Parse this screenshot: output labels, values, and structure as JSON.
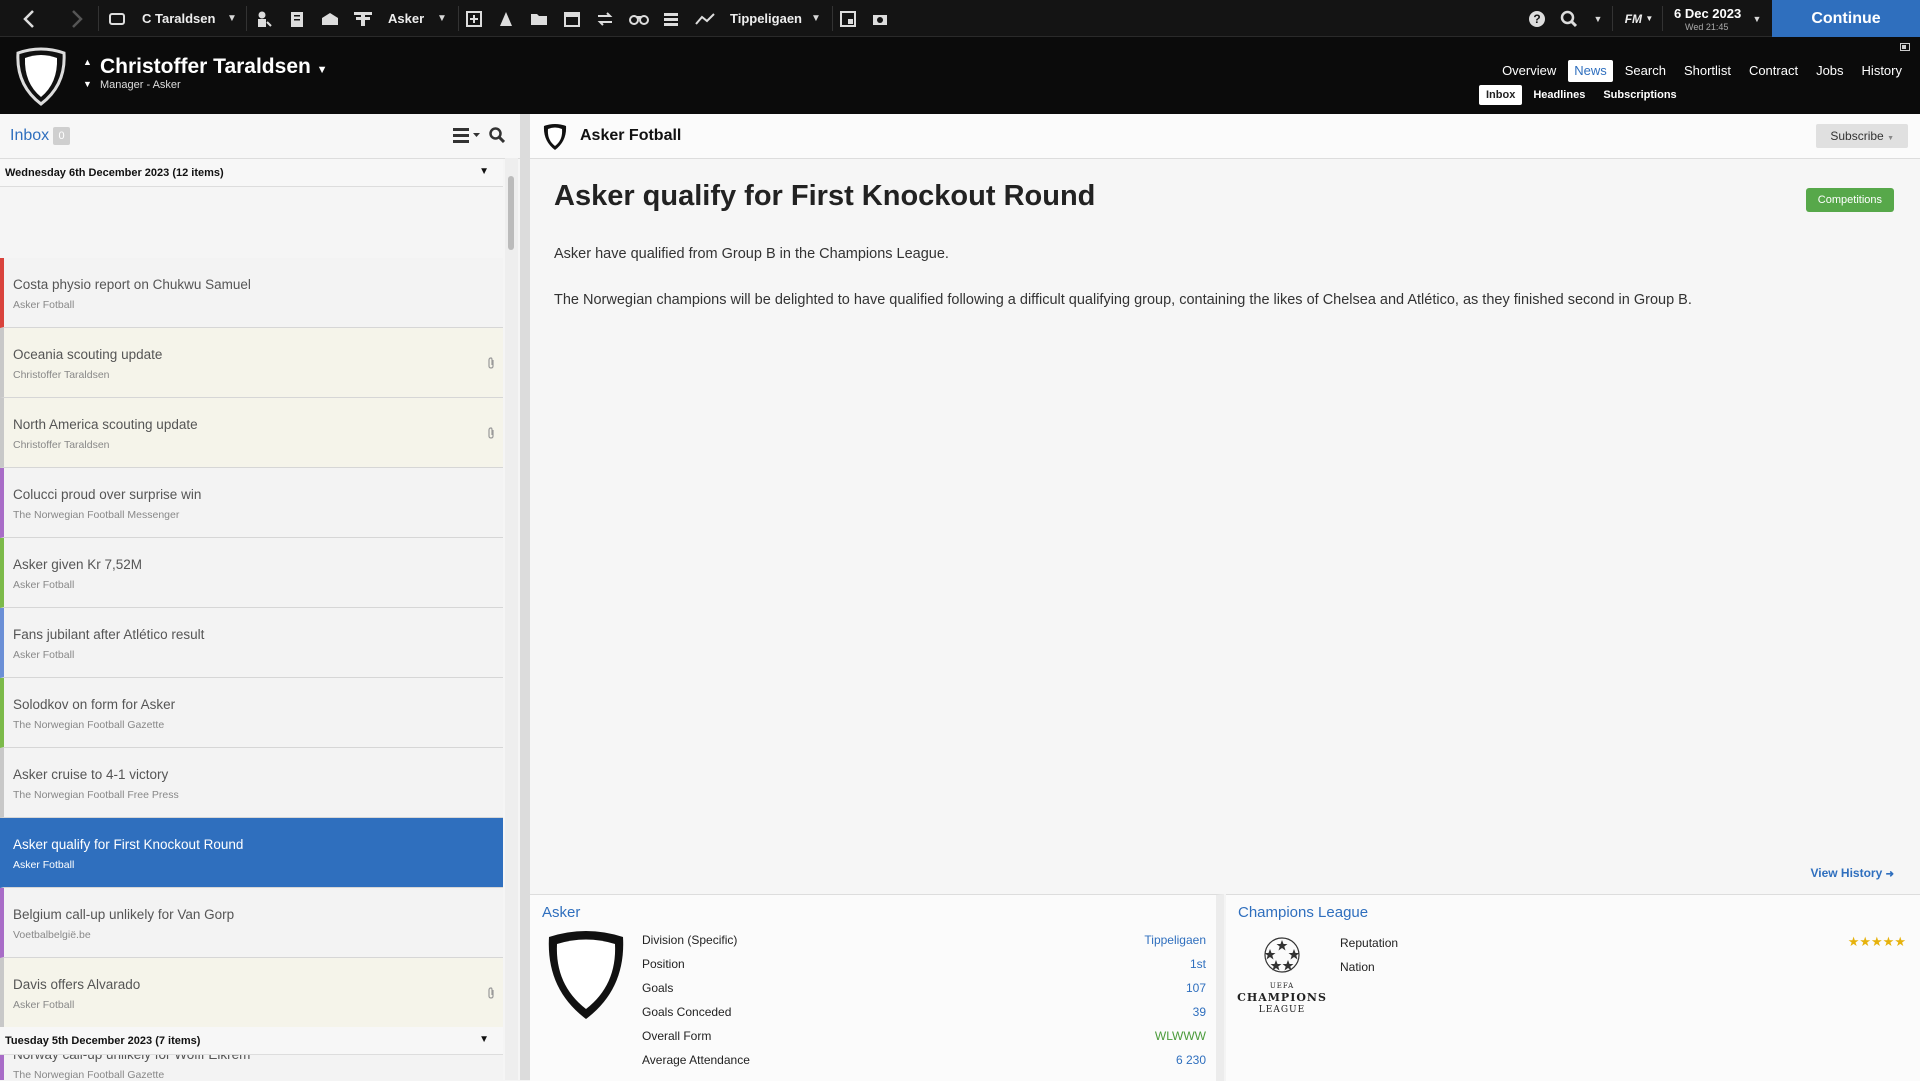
{
  "toolbar": {
    "manager_short": "C Taraldsen",
    "club": "Asker",
    "league": "Tippeligaen",
    "fm_label": "FM",
    "date": "6 Dec 2023",
    "day_time": "Wed 21:45",
    "continue": "Continue"
  },
  "header": {
    "name": "Christoffer Taraldsen",
    "role": "Manager - Asker",
    "nav": [
      "Overview",
      "News",
      "Search",
      "Shortlist",
      "Contract",
      "Jobs",
      "History"
    ],
    "subnav": [
      "Inbox",
      "Headlines",
      "Subscriptions"
    ]
  },
  "inbox": {
    "title": "Inbox",
    "count": "0",
    "group1": "Wednesday 6th December 2023 (12 items)",
    "group2": "Tuesday 5th December 2023 (7 items)",
    "messages": [
      {
        "subject": "Costa physio report on Chukwu Samuel",
        "from": "Asker Fotball"
      },
      {
        "subject": "Oceania scouting update",
        "from": "Christoffer Taraldsen"
      },
      {
        "subject": "North America scouting update",
        "from": "Christoffer Taraldsen"
      },
      {
        "subject": "Colucci proud over surprise win",
        "from": "The Norwegian Football Messenger"
      },
      {
        "subject": "Asker given Kr 7,52M",
        "from": "Asker Fotball"
      },
      {
        "subject": "Fans jubilant after Atlético result",
        "from": "Asker Fotball"
      },
      {
        "subject": "Solodkov on form for Asker",
        "from": "The Norwegian Football Gazette"
      },
      {
        "subject": "Asker cruise to 4-1 victory",
        "from": "The Norwegian Football Free Press"
      },
      {
        "subject": "Asker qualify for First Knockout Round",
        "from": "Asker Fotball"
      },
      {
        "subject": "Belgium call-up unlikely for Van Gorp",
        "from": "Voetbalbelgië.be"
      },
      {
        "subject": "Davis offers Alvarado",
        "from": "Asker Fotball"
      },
      {
        "subject": "Norway call-up unlikely for Wolff Eikrem",
        "from": "The Norwegian Football Gazette"
      }
    ]
  },
  "article": {
    "source": "Asker Fotball",
    "subscribe": "Subscribe",
    "title": "Asker qualify for First Knockout Round",
    "competitions": "Competitions",
    "p1": "Asker have qualified from Group B in the Champions League.",
    "p2": "The Norwegian champions will be delighted to have qualified following a difficult qualifying group, containing the likes of Chelsea and Atlético, as they finished second in Group B.",
    "view_history": "View History"
  },
  "club_card": {
    "title": "Asker",
    "rows": [
      {
        "label": "Division (Specific)",
        "value": "Tippeligaen"
      },
      {
        "label": "Position",
        "value": "1st"
      },
      {
        "label": "Goals",
        "value": "107"
      },
      {
        "label": "Goals Conceded",
        "value": "39"
      },
      {
        "label": "Overall Form",
        "value": "WLWWW"
      },
      {
        "label": "Average Attendance",
        "value": "6 230"
      }
    ]
  },
  "comp_card": {
    "title": "Champions League",
    "logo_line1": "CHAMPIONS",
    "logo_line2": "LEAGUE",
    "logo_uefa": "UEFA",
    "reputation_label": "Reputation",
    "reputation_stars": 5,
    "nation_label": "Nation"
  },
  "colors": {
    "accent": "#2f6fbe",
    "green": "#57a84a",
    "stars": "#e6b20c"
  },
  "stripe_colors": [
    "#d9433c",
    "#c8c8c8",
    "#c8c8c8",
    "#a86cc7",
    "#7cba4a",
    "#6b8fd6",
    "#7cba4a",
    "#c8c8c8",
    "#2f6fbe",
    "#a86cc7",
    "#c8c8c8",
    "#a86cc7"
  ]
}
